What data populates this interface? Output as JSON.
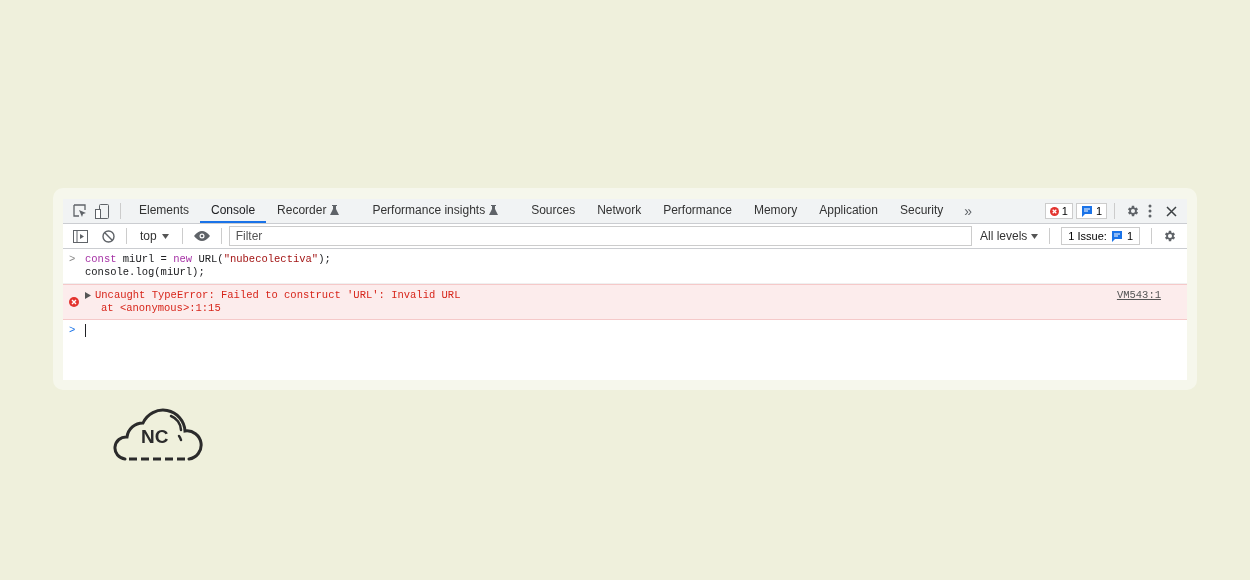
{
  "tabs": [
    {
      "label": "Elements",
      "selected": false
    },
    {
      "label": "Console",
      "selected": true
    },
    {
      "label": "Recorder",
      "selected": false,
      "experimental": true
    },
    {
      "label": "Performance insights",
      "selected": false,
      "experimental": true
    },
    {
      "label": "Sources",
      "selected": false
    },
    {
      "label": "Network",
      "selected": false
    },
    {
      "label": "Performance",
      "selected": false
    },
    {
      "label": "Memory",
      "selected": false
    },
    {
      "label": "Application",
      "selected": false
    },
    {
      "label": "Security",
      "selected": false
    }
  ],
  "more_tabs": "»",
  "error_count": "1",
  "message_count": "1",
  "toolbar": {
    "context": "top",
    "filter_placeholder": "Filter",
    "levels": "All levels",
    "issues_label": "1 Issue:",
    "issues_count": "1"
  },
  "entries": [
    {
      "kind": "input",
      "prompt": ">",
      "lines": [
        [
          {
            "text": "const",
            "kind": "keyword"
          },
          {
            "text": " miUrl = ",
            "kind": "plain"
          },
          {
            "text": "new",
            "kind": "keyword"
          },
          {
            "text": " URL(",
            "kind": "plain"
          },
          {
            "text": "\"nubecolectiva\"",
            "kind": "string"
          },
          {
            "text": ");",
            "kind": "plain"
          }
        ],
        [
          {
            "text": "console.log(miUrl);",
            "kind": "plain"
          }
        ]
      ]
    },
    {
      "kind": "error",
      "message": "Uncaught TypeError: Failed to construct 'URL': Invalid URL",
      "stack": "at <anonymous>:1:15",
      "source": "VM543:1"
    }
  ],
  "prompt": ">",
  "logo": "NC"
}
